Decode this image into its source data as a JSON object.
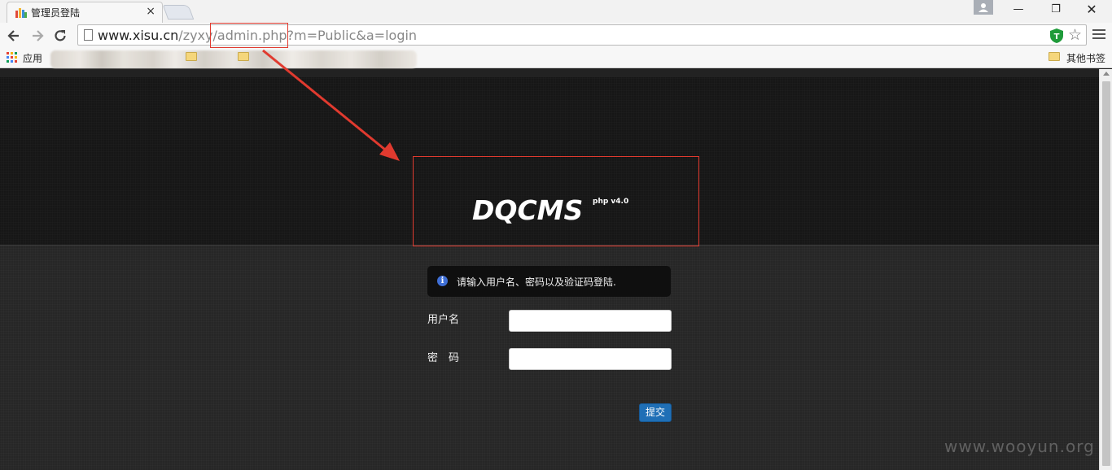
{
  "browser": {
    "tab_title": "管理员登陆",
    "tab_close": "×",
    "url_host": "www.xisu.cn",
    "url_rest": "/zyxy/admin.php?m=Public&a=login",
    "window_controls": {
      "minimize": "—",
      "maximize": "❐",
      "close": "✕"
    },
    "bookmarks": {
      "apps_label": "应用",
      "other_label": "其他书签"
    }
  },
  "page": {
    "logo": "DQCMS",
    "logo_version": "php v4.0",
    "info_message": "请输入用户名、密码以及验证码登陆.",
    "username_label": "用户名",
    "password_label": "密　码",
    "submit_label": "提交",
    "watermark": "www.wooyun.org"
  },
  "colors": {
    "annotation_red": "#e03a2f",
    "submit_blue": "#1f6fb6",
    "info_icon_blue": "#3f6fd6"
  },
  "icons": [
    "back-arrow-icon",
    "forward-arrow-icon",
    "reload-icon",
    "page-icon",
    "shield-extension-icon",
    "star-icon",
    "menu-icon",
    "apps-grid-icon",
    "folder-icon",
    "info-icon",
    "profile-icon"
  ]
}
